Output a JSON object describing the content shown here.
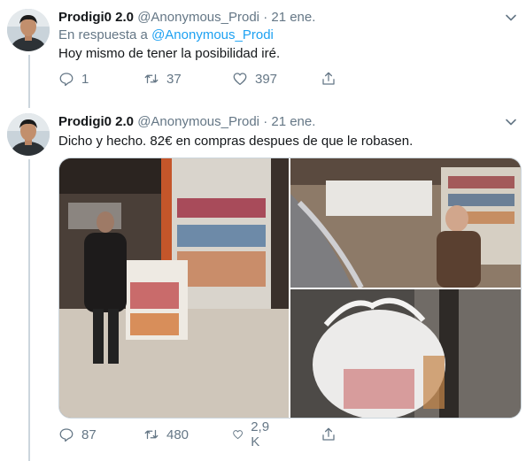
{
  "tweets": [
    {
      "display_name": "Prodigi0 2.0",
      "handle": "@Anonymous_Prodi",
      "separator": "·",
      "time": "21 ene.",
      "reply_prefix": "En respuesta a",
      "reply_handle": "@Anonymous_Prodi",
      "text": "Hoy mismo de tener la posibilidad iré.",
      "replies": "1",
      "retweets": "37",
      "likes": "397"
    },
    {
      "display_name": "Prodigi0 2.0",
      "handle": "@Anonymous_Prodi",
      "separator": "·",
      "time": "21 ene.",
      "text": "Dicho y hecho. 82€ en compras despues de que le robasen.",
      "replies": "87",
      "retweets": "480",
      "likes": "2,9 K"
    }
  ],
  "icons": {
    "reply": "reply-icon",
    "retweet": "retweet-icon",
    "like": "heart-icon",
    "share": "share-icon",
    "more": "chevron-down-icon"
  },
  "colors": {
    "link": "#1da1f2",
    "secondary_text": "#657786",
    "thread_line": "#ccd6dd"
  }
}
